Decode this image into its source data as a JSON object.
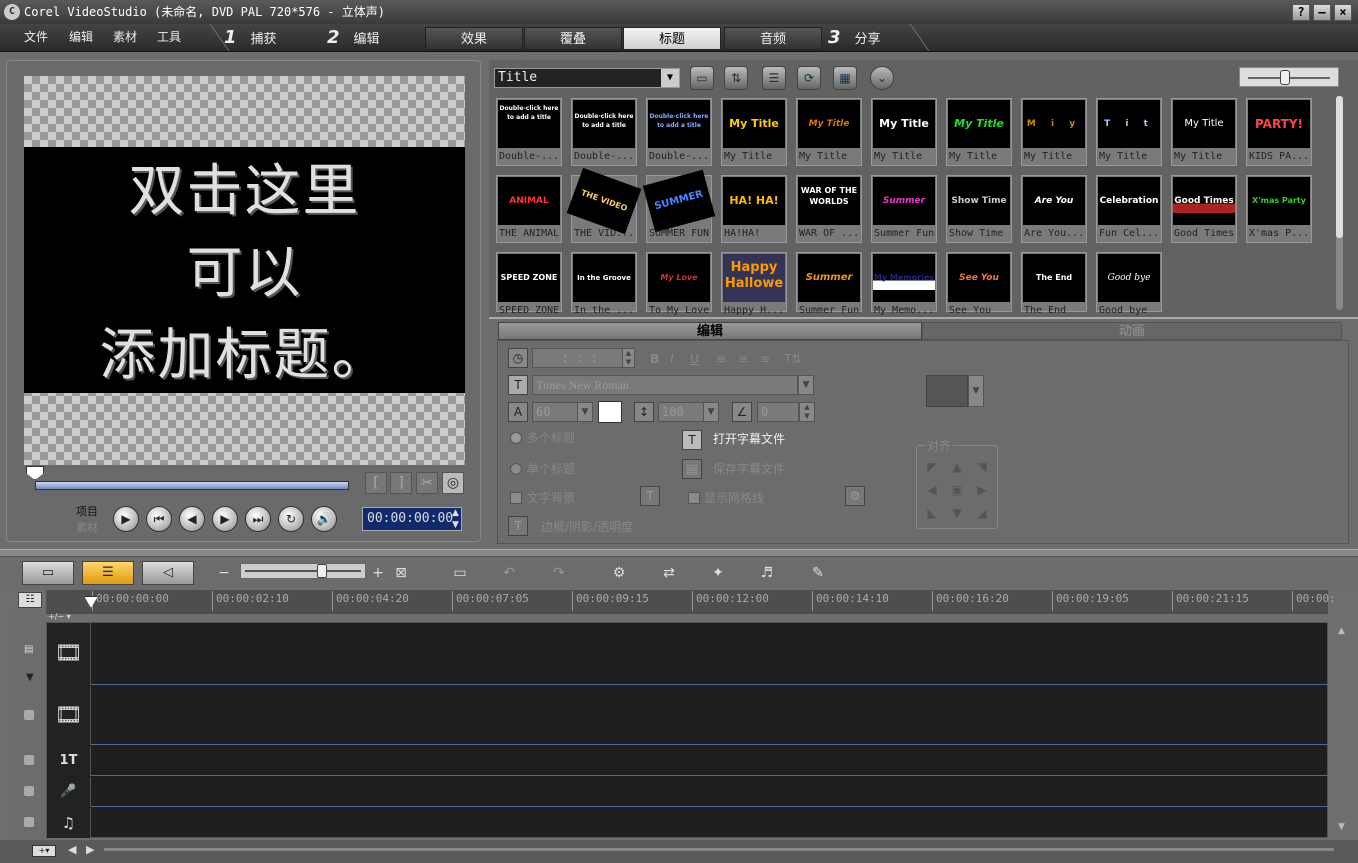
{
  "window": {
    "title": "Corel VideoStudio (未命名, DVD PAL 720*576 - 立体声)",
    "logo": "logo-icon",
    "buttons": [
      "?",
      "–",
      "×"
    ]
  },
  "menu": [
    "文件",
    "编辑",
    "素材",
    "工具"
  ],
  "steps": [
    {
      "num": "1",
      "label": "捕获"
    },
    {
      "num": "2",
      "label": "编辑"
    },
    {
      "num": "3",
      "label": "分享"
    }
  ],
  "tabs": [
    {
      "label": "效果",
      "active": false
    },
    {
      "label": "覆叠",
      "active": false
    },
    {
      "label": "标题",
      "active": true
    },
    {
      "label": "音频",
      "active": false
    }
  ],
  "preview": {
    "lines": [
      "双击这里",
      "可以",
      "添加标题。"
    ],
    "mode_project": "项目",
    "mode_clip": "素材",
    "timecode": "00:00:00:00",
    "mark_buttons": [
      "[",
      "]",
      "✂",
      "◎"
    ],
    "playback": [
      "play-icon",
      "start-icon",
      "prev-frame-icon",
      "next-frame-icon",
      "end-icon",
      "repeat-icon",
      "volume-icon"
    ]
  },
  "library": {
    "selected": "Title",
    "thumbs": [
      {
        "cap": "Double-...",
        "art": "Double-click here to add a title"
      },
      {
        "cap": "Double-...",
        "art": "Double-click here to add a title"
      },
      {
        "cap": "Double-...",
        "art": "Double-click here to add a title"
      },
      {
        "cap": "My Title",
        "art": "My Title"
      },
      {
        "cap": "My Title",
        "art": "My Title"
      },
      {
        "cap": "My Title",
        "art": "My Title"
      },
      {
        "cap": "My Title",
        "art": "My Title"
      },
      {
        "cap": "My Title",
        "art": "M i y t"
      },
      {
        "cap": "My Title",
        "art": "T i t"
      },
      {
        "cap": "My Title",
        "art": "My Title"
      },
      {
        "cap": "KIDS PA...",
        "art": "PARTY!"
      },
      {
        "cap": "THE ANIMAL",
        "art": "ANIMAL"
      },
      {
        "cap": "THE VID...",
        "art": "THE VIDEO"
      },
      {
        "cap": "SUMMER FUN",
        "art": "SUMMER FUN"
      },
      {
        "cap": "HA!HA!",
        "art": "HA! HA!"
      },
      {
        "cap": "WAR OF ...",
        "art": "WAR OF THE WORLDS"
      },
      {
        "cap": "Summer Fun",
        "art": "Summer Fun"
      },
      {
        "cap": "Show Time",
        "art": "Show Time"
      },
      {
        "cap": "Are You...",
        "art": "Are You Ready?"
      },
      {
        "cap": "Fun Cel...",
        "art": "Celebration"
      },
      {
        "cap": "Good Times",
        "art": "Good Times"
      },
      {
        "cap": "X'mas P...",
        "art": "X'mas Party"
      },
      {
        "cap": "SPEED ZONE",
        "art": "SPEED ZONE"
      },
      {
        "cap": "In the ...",
        "art": "In the Groove"
      },
      {
        "cap": "To My Love",
        "art": "My Love"
      },
      {
        "cap": "Happy H...",
        "art": "Happy Hallowe"
      },
      {
        "cap": "Summer Fun",
        "art": "Summer Fun"
      },
      {
        "cap": "My Memo...",
        "art": "My Memories"
      },
      {
        "cap": "See You",
        "art": "See You"
      },
      {
        "cap": "The End",
        "art": "The End"
      },
      {
        "cap": "Good bye",
        "art": "Good bye"
      }
    ]
  },
  "options": {
    "tab_edit": "编辑",
    "tab_anim": "动画",
    "duration": ": : :",
    "font": "Times New Roman",
    "size": "60",
    "line_spacing": "100",
    "angle": "0",
    "multi_title": "多个标题",
    "single_title": "单个标题",
    "text_bg": "文字背景",
    "open_subtitle": "打开字幕文件",
    "save_subtitle": "保存字幕文件",
    "show_grid": "显示网格线",
    "align_label": "对齐",
    "border_shadow": "边框/阴影/透明度",
    "format_buttons": [
      "B",
      "I",
      "U"
    ]
  },
  "timeline": {
    "ruler": [
      "00:00:00:00",
      "00:00:02:10",
      "00:00:04:20",
      "00:00:07:05",
      "00:00:09:15",
      "00:00:12:00",
      "00:00:14:10",
      "00:00:16:20",
      "00:00:19:05",
      "00:00:21:15",
      "00:00:"
    ],
    "tracks": [
      {
        "name": "video-track",
        "icon": "film-icon"
      },
      {
        "name": "overlay-track",
        "icon": "overlay-film-icon"
      },
      {
        "name": "title-track",
        "icon": "title-icon"
      },
      {
        "name": "voice-track",
        "icon": "microphone-icon"
      },
      {
        "name": "music-track",
        "icon": "music-note-icon"
      }
    ],
    "track_glyphs": [
      "🎞",
      "🎞",
      "1T",
      "🎤",
      "♫"
    ]
  }
}
